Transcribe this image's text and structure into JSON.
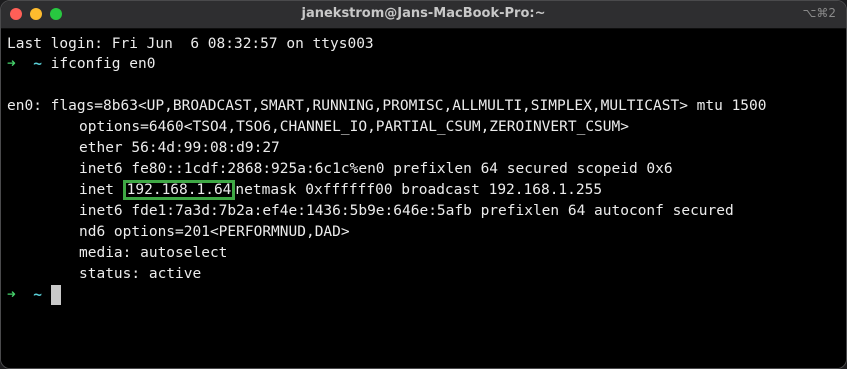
{
  "window": {
    "title": "janekstrom@Jans-MacBook-Pro:~",
    "shortcut": "⌥⌘2",
    "traffic_lights": {
      "close_color": "#ff5f57",
      "minimize_color": "#febc2e",
      "zoom_color": "#28c840"
    }
  },
  "terminal": {
    "login_line": "Last login: Fri Jun  6 08:32:57 on ttys003",
    "prompt_arrow": "➜",
    "prompt_dir": "~",
    "command": "ifconfig en0",
    "output": {
      "flags_line": "en0: flags=8b63<UP,BROADCAST,SMART,RUNNING,PROMISC,ALLMULTI,SIMPLEX,MULTICAST> mtu 1500",
      "options_line": "options=6460<TSO4,TSO6,CHANNEL_IO,PARTIAL_CSUM,ZEROINVERT_CSUM>",
      "ether_line": "ether 56:4d:99:08:d9:27",
      "inet6_link_line": "inet6 fe80::1cdf:2868:925a:6c1c%en0 prefixlen 64 secured scopeid 0x6",
      "inet_prefix": "inet ",
      "inet_address": "192.168.1.64",
      "inet_suffix": "netmask 0xffffff00 broadcast 192.168.1.255",
      "inet6_global_line": "inet6 fde1:7a3d:7b2a:ef4e:1436:5b9e:646e:5afb prefixlen 64 autoconf secured",
      "nd6_line": "nd6 options=201<PERFORMNUD,DAD>",
      "media_line": "media: autoselect",
      "status_line": "status: active"
    },
    "colors": {
      "highlight_box": "#3fa845",
      "prompt_arrow": "#45d06a",
      "prompt_dir": "#5ad0d8"
    }
  }
}
